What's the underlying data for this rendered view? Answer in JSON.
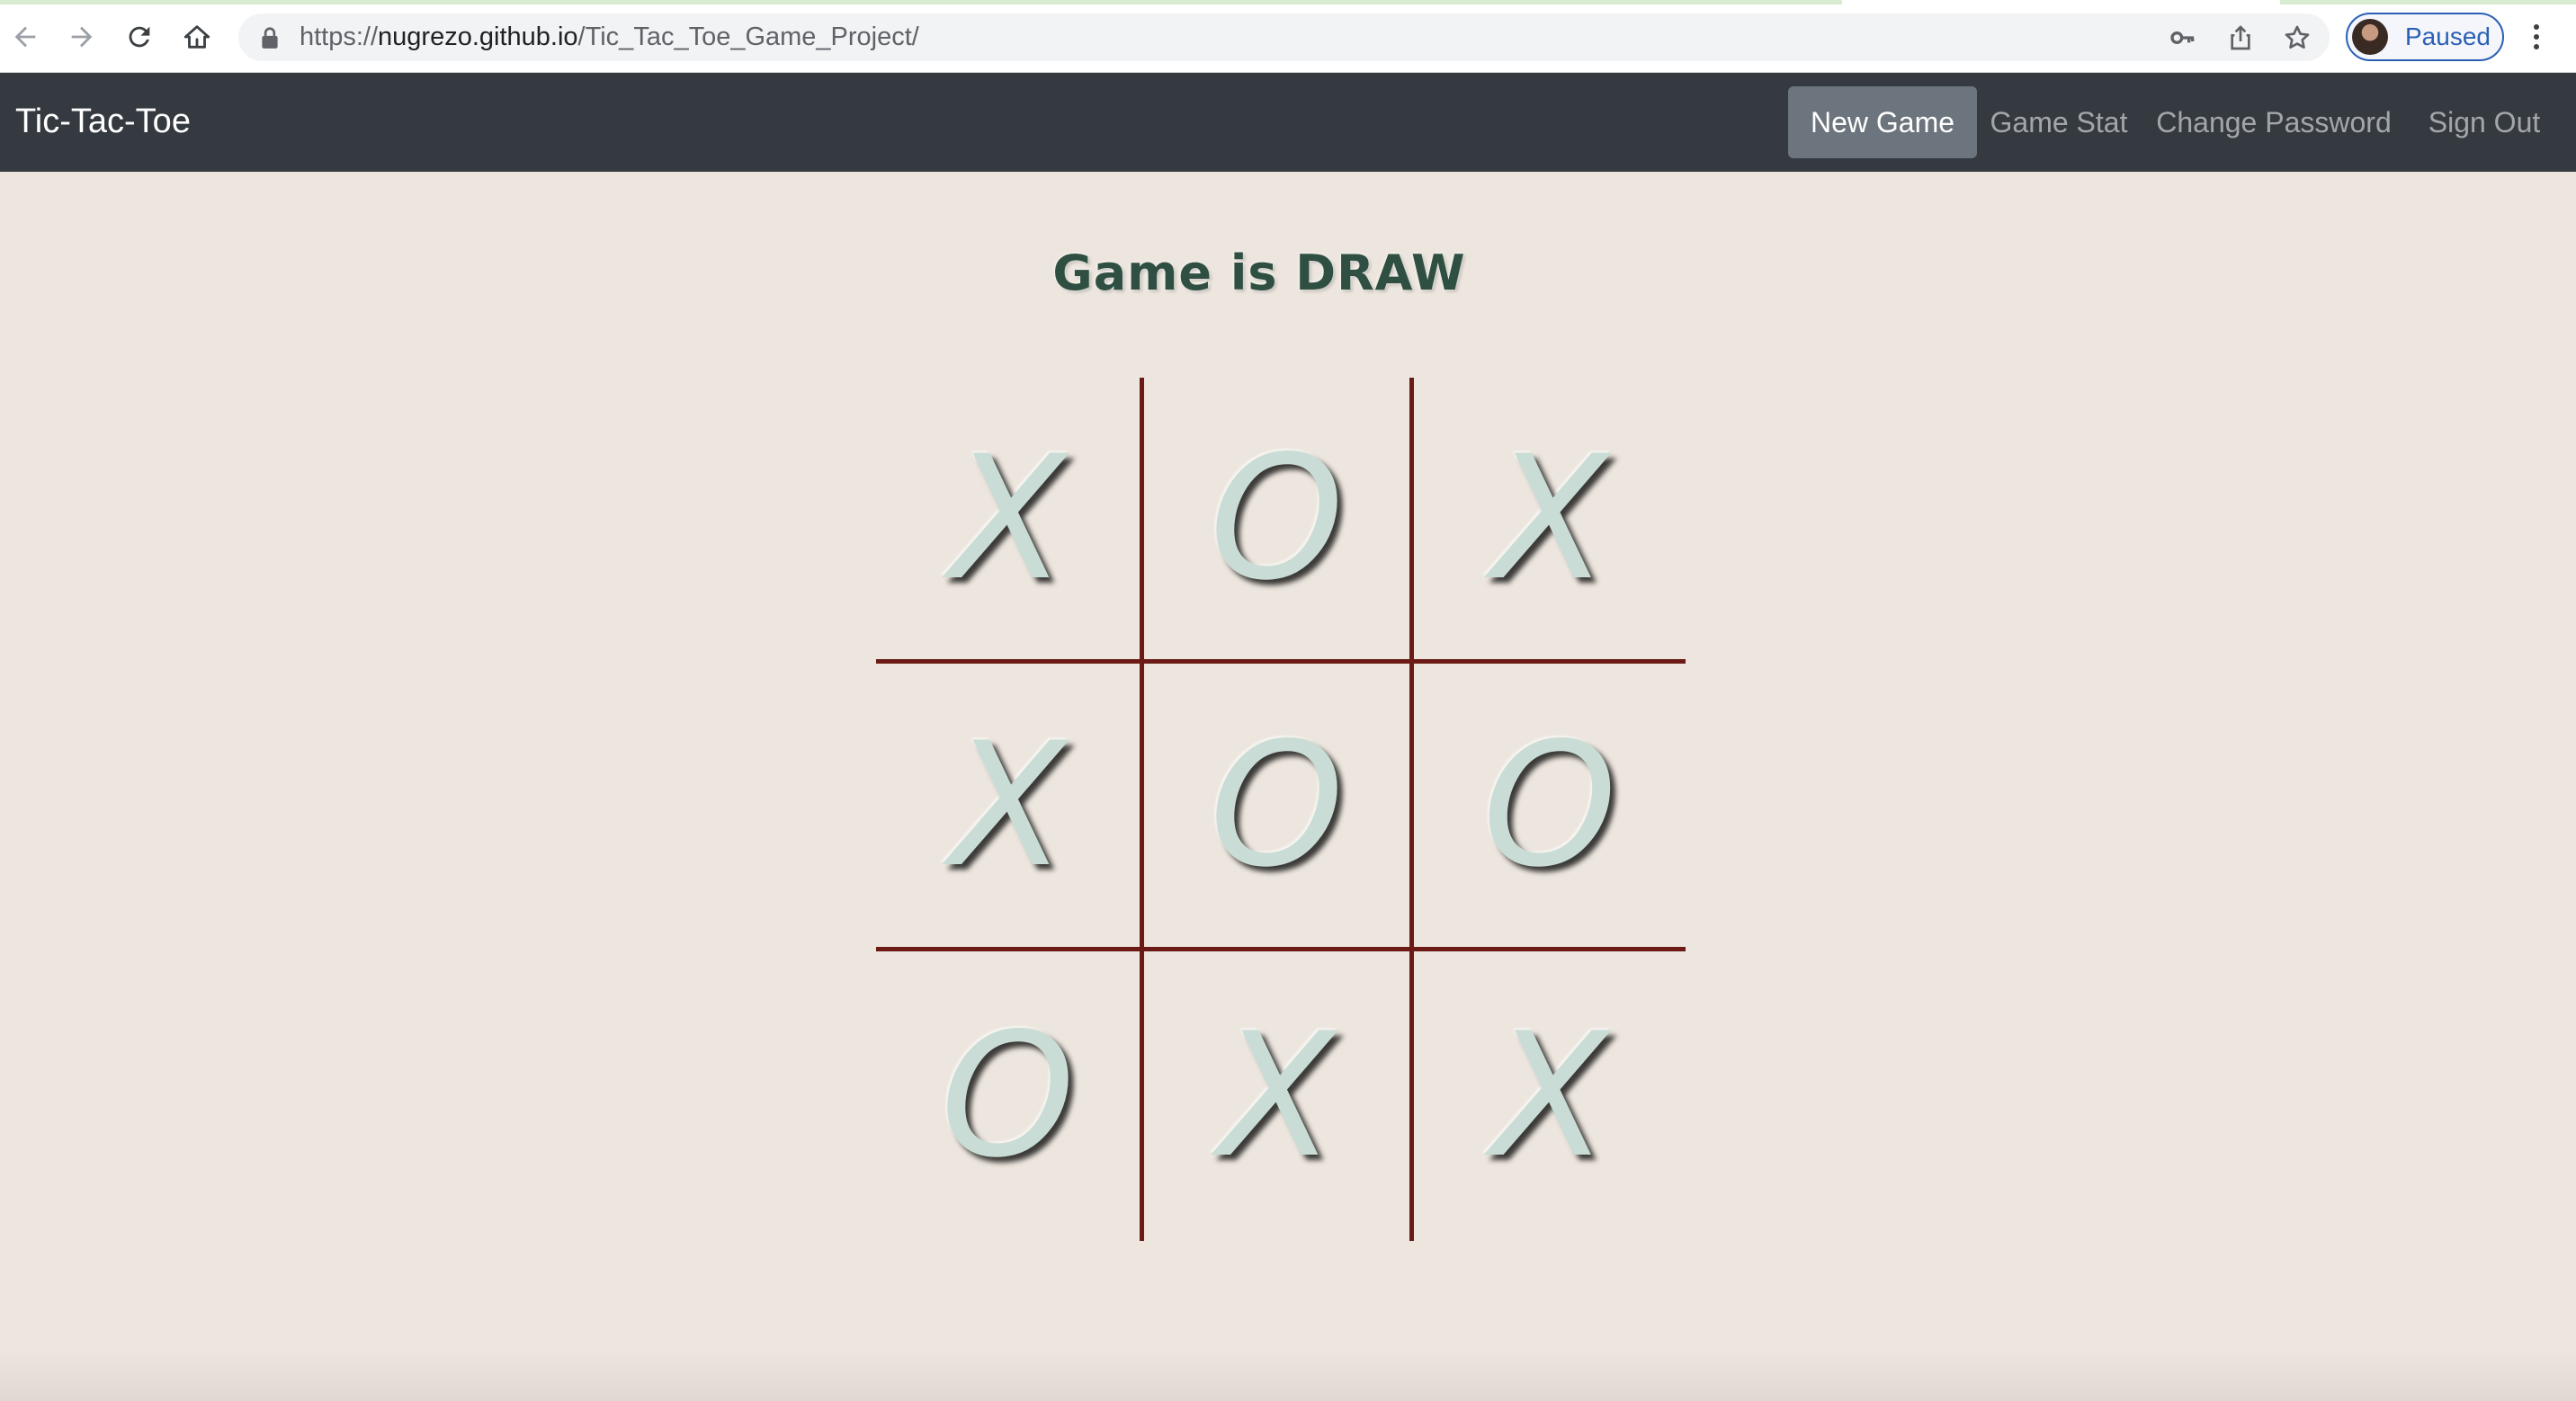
{
  "browser": {
    "url_scheme": "https://",
    "url_host": "nugrezo.github.io",
    "url_path": "/Tic_Tac_Toe_Game_Project/",
    "profile_label": "Paused"
  },
  "navbar": {
    "brand": "Tic-Tac-Toe",
    "links": [
      "New Game",
      "Game Stat",
      "Change Password",
      "Sign Out"
    ],
    "active": "New Game"
  },
  "game": {
    "status": "Game is DRAW",
    "board": [
      "X",
      "O",
      "X",
      "X",
      "O",
      "O",
      "O",
      "X",
      "X"
    ]
  },
  "colors": {
    "background": "#ede6de",
    "navbar": "#343a40",
    "grid_line": "#6b1a16",
    "mark": "#c9dcd5",
    "status_text": "#2f4f42"
  }
}
